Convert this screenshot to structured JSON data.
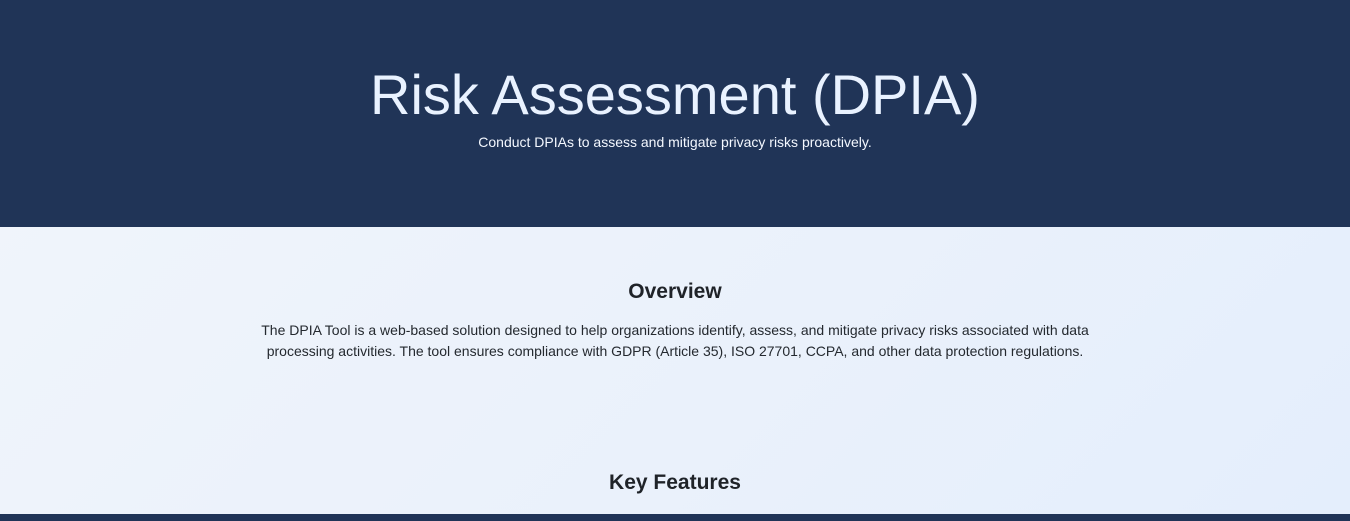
{
  "hero": {
    "title": "Risk Assessment (DPIA)",
    "subtitle": "Conduct DPIAs to assess and mitigate privacy risks proactively."
  },
  "overview": {
    "heading": "Overview",
    "text": "The DPIA Tool is a web-based solution designed to help organizations identify, assess, and mitigate privacy risks associated with data processing activities. The tool ensures compliance with GDPR (Article 35), ISO 27701, CCPA, and other data protection regulations."
  },
  "features": {
    "heading": "Key Features"
  },
  "colors": {
    "hero_background": "#203457",
    "content_background": "#eaf1fb",
    "heading_text": "#1f2328"
  }
}
